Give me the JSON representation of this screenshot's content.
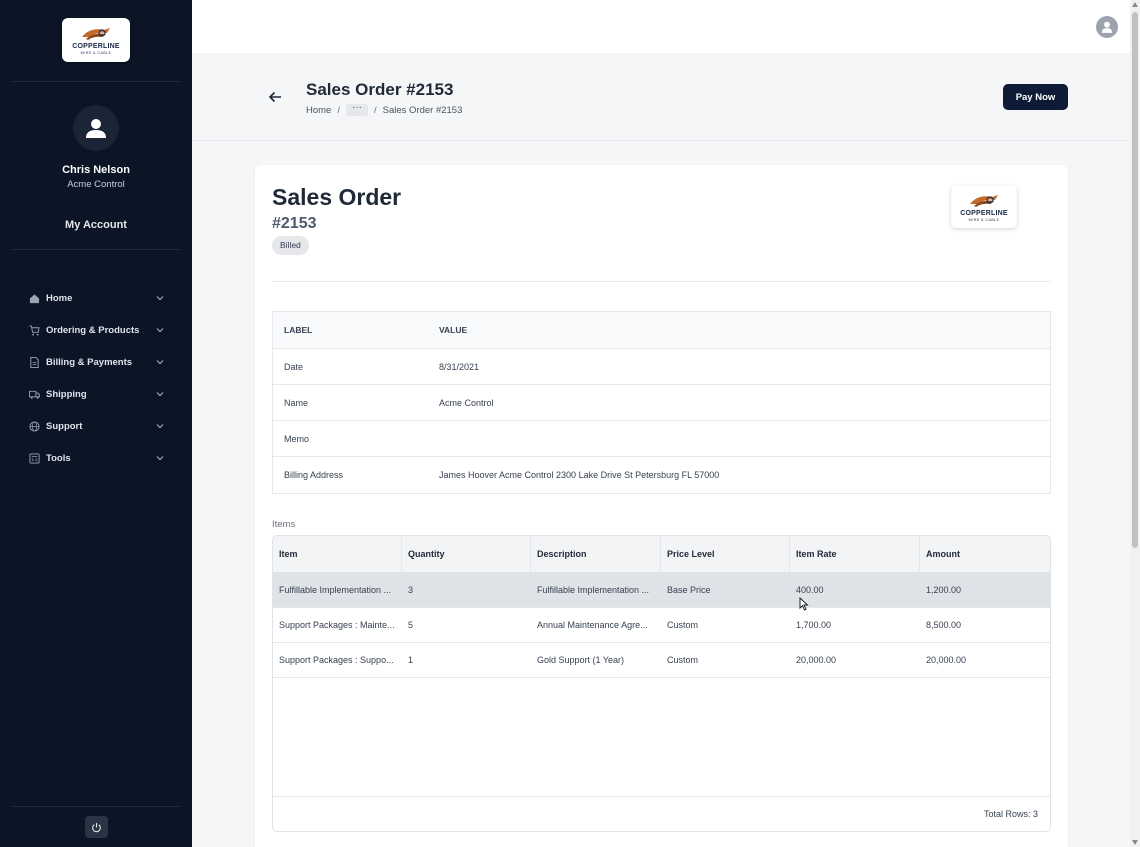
{
  "sidebar": {
    "logo_text": "COPPERLINE",
    "logo_sub": "WIRE & CABLE",
    "user_name": "Chris Nelson",
    "user_company": "Acme Control",
    "my_account": "My Account",
    "nav": [
      {
        "label": "Home",
        "icon": "home-icon"
      },
      {
        "label": "Ordering & Products",
        "icon": "cart-icon"
      },
      {
        "label": "Billing & Payments",
        "icon": "document-icon"
      },
      {
        "label": "Shipping",
        "icon": "truck-icon"
      },
      {
        "label": "Support",
        "icon": "globe-icon"
      },
      {
        "label": "Tools",
        "icon": "calculator-icon"
      }
    ]
  },
  "header": {
    "title": "Sales Order #2153",
    "breadcrumb": {
      "home": "Home",
      "ellipsis": "···",
      "current": "Sales Order #2153"
    },
    "pay_button": "Pay Now"
  },
  "document": {
    "title": "Sales Order",
    "number": "#2153",
    "status": "Billed",
    "logo_text": "COPPERLINE",
    "logo_sub": "WIRE & CABLE",
    "info_headers": {
      "label": "LABEL",
      "value": "VALUE"
    },
    "info_rows": [
      {
        "label": "Date",
        "value": "8/31/2021"
      },
      {
        "label": "Name",
        "value": "Acme Control"
      },
      {
        "label": "Memo",
        "value": ""
      },
      {
        "label": "Billing Address",
        "value": "James Hoover Acme Control 2300 Lake Drive St Petersburg FL 57000"
      }
    ]
  },
  "items": {
    "section_label": "Items",
    "columns": [
      "Item",
      "Quantity",
      "Description",
      "Price Level",
      "Item Rate",
      "Amount"
    ],
    "rows": [
      [
        "Fulfillable Implementation ...",
        "3",
        "Fulfillable Implementation ...",
        "Base Price",
        "400.00",
        "1,200.00"
      ],
      [
        "Support Packages : Mainte...",
        "5",
        "Annual Maintenance Agre...",
        "Custom",
        "1,700.00",
        "8,500.00"
      ],
      [
        "Support Packages : Suppo...",
        "1",
        "Gold Support (1 Year)",
        "Custom",
        "20,000.00",
        "20,000.00"
      ]
    ],
    "total_rows": "Total Rows: 3"
  },
  "colors": {
    "sidebar_bg": "#0b1526",
    "primary_button": "#0d1b36",
    "hover_row": "#dfe2e7"
  }
}
